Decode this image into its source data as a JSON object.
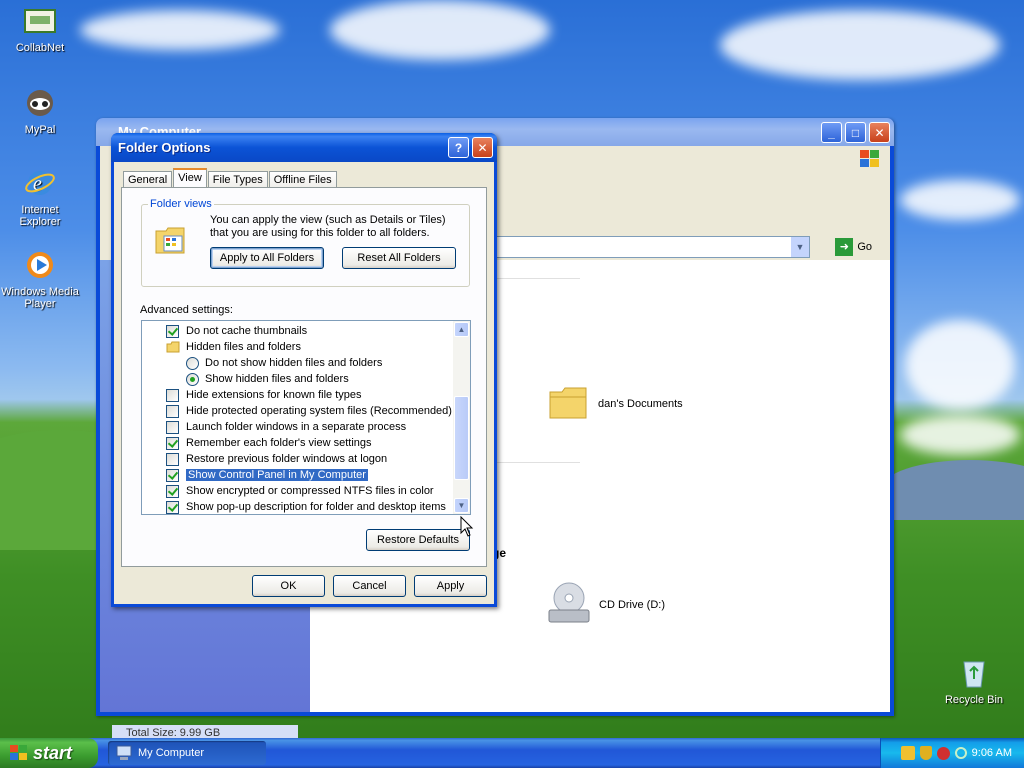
{
  "desktop": {
    "icons": [
      {
        "label": "CollabNet"
      },
      {
        "label": "MyPal"
      },
      {
        "label": "Internet Explorer"
      },
      {
        "label": "Windows Media Player"
      },
      {
        "label": "Recycle Bin"
      }
    ]
  },
  "back_window": {
    "title": "My Computer",
    "go_label": "Go",
    "items": [
      {
        "label": "dan's Documents",
        "icon": "folder-icon"
      },
      {
        "label": "CD Drive (D:)",
        "icon": "cd-drive-icon"
      }
    ],
    "partial_heading": "ge",
    "left_pane_text": "Total Size: 9.99 GB"
  },
  "dialog": {
    "title": "Folder Options",
    "help_label": "?",
    "close_label": "✕",
    "tabs": [
      {
        "label": "General"
      },
      {
        "label": "View",
        "active": true
      },
      {
        "label": "File Types"
      },
      {
        "label": "Offline Files"
      }
    ],
    "folder_views": {
      "label": "Folder views",
      "description": "You can apply the view (such as Details or Tiles) that you are using for this folder to all folders.",
      "apply_all": "Apply to All Folders",
      "reset_all": "Reset All Folders"
    },
    "advanced_label": "Advanced settings:",
    "settings": [
      {
        "label": "Do not cache thumbnails",
        "kind": "checkbox",
        "checked": true,
        "indent": 0
      },
      {
        "label": "Hidden files and folders",
        "kind": "folder",
        "checked": false,
        "indent": 0
      },
      {
        "label": "Do not show hidden files and folders",
        "kind": "radio",
        "checked": false,
        "indent": 1
      },
      {
        "label": "Show hidden files and folders",
        "kind": "radio",
        "checked": true,
        "indent": 1
      },
      {
        "label": "Hide extensions for known file types",
        "kind": "checkbox",
        "checked": false,
        "indent": 0
      },
      {
        "label": "Hide protected operating system files (Recommended)",
        "kind": "checkbox",
        "checked": false,
        "indent": 0
      },
      {
        "label": "Launch folder windows in a separate process",
        "kind": "checkbox",
        "checked": false,
        "indent": 0
      },
      {
        "label": "Remember each folder's view settings",
        "kind": "checkbox",
        "checked": true,
        "indent": 0
      },
      {
        "label": "Restore previous folder windows at logon",
        "kind": "checkbox",
        "checked": false,
        "indent": 0
      },
      {
        "label": "Show Control Panel in My Computer",
        "kind": "checkbox",
        "checked": true,
        "indent": 0,
        "selected": true
      },
      {
        "label": "Show encrypted or compressed NTFS files in color",
        "kind": "checkbox",
        "checked": true,
        "indent": 0
      },
      {
        "label": "Show pop-up description for folder and desktop items",
        "kind": "checkbox",
        "checked": true,
        "indent": 0
      }
    ],
    "restore_defaults": "Restore Defaults",
    "ok": "OK",
    "cancel": "Cancel",
    "apply": "Apply"
  },
  "taskbar": {
    "start_label": "start",
    "task_label": "My Computer",
    "clock": "9:06 AM"
  }
}
